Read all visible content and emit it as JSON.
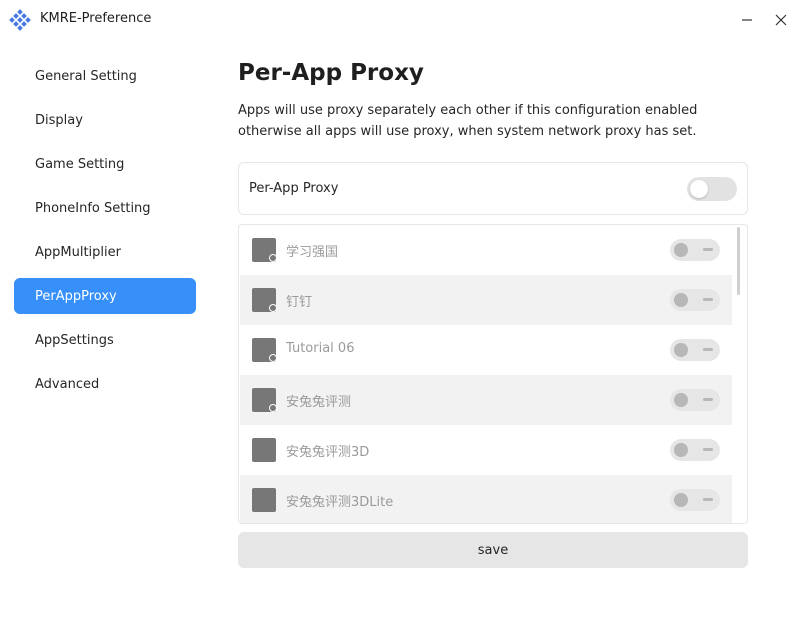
{
  "window": {
    "title": "KMRE-Preference"
  },
  "sidebar": {
    "items": [
      {
        "label": "General Setting"
      },
      {
        "label": "Display"
      },
      {
        "label": "Game Setting"
      },
      {
        "label": "PhoneInfo Setting"
      },
      {
        "label": "AppMultiplier"
      },
      {
        "label": "PerAppProxy",
        "active": true
      },
      {
        "label": "AppSettings"
      },
      {
        "label": "Advanced"
      }
    ]
  },
  "main": {
    "title": "Per-App Proxy",
    "description": "Apps will use proxy separately each other if this configuration enabled otherwise all apps will use proxy, when system network proxy has set.",
    "proxy_toggle": {
      "label": "Per-App Proxy",
      "enabled": false
    },
    "apps": [
      {
        "name": "学习强国",
        "enabled": false,
        "badge": true
      },
      {
        "name": "钉钉",
        "enabled": false,
        "badge": true
      },
      {
        "name": "Tutorial 06",
        "enabled": false,
        "badge": true
      },
      {
        "name": "安兔兔评测",
        "enabled": false,
        "badge": true
      },
      {
        "name": "安兔兔评测3D",
        "enabled": false,
        "badge": false
      },
      {
        "name": "安兔兔评测3DLite",
        "enabled": false,
        "badge": false
      }
    ],
    "save_label": "save"
  },
  "colors": {
    "accent": "#3790fa",
    "row_alt": "#f2f2f2",
    "disabled_text": "#9a9a9a"
  },
  "icons": {
    "app_logo": "app-logo-icon",
    "minimize": "minimize-icon",
    "close": "close-icon",
    "app_placeholder": "app-placeholder-icon"
  }
}
